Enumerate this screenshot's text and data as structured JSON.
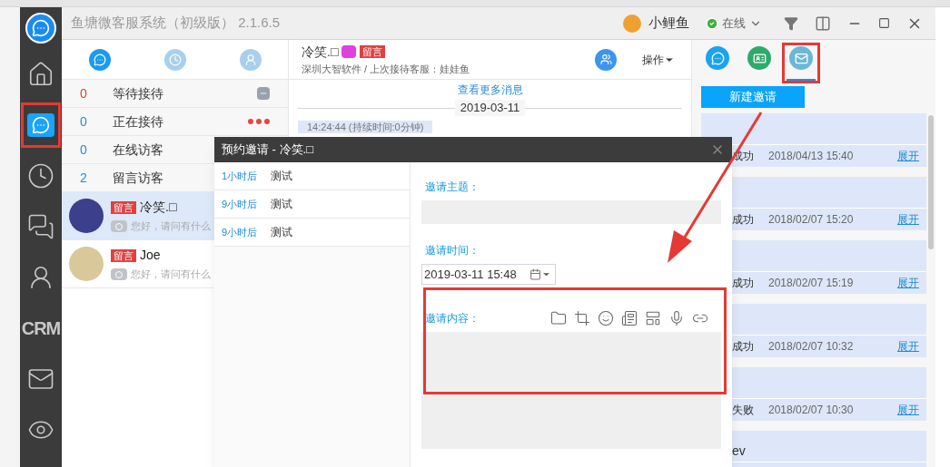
{
  "window": {
    "title": "鱼塘微客服系统（初级版） 2.1.6.5",
    "user": "小鲤鱼",
    "status": "在线"
  },
  "nav": [
    {
      "selected": false,
      "highlighted": false
    },
    {
      "selected": true,
      "highlighted": true
    },
    {
      "selected": false,
      "highlighted": false
    },
    {
      "selected": false,
      "highlighted": false
    },
    {
      "selected": false,
      "highlighted": false
    },
    {
      "label": "CRM",
      "selected": false,
      "highlighted": false
    },
    {
      "selected": false,
      "highlighted": false
    },
    {
      "selected": false,
      "highlighted": false
    }
  ],
  "visitor_tabs": [
    {
      "selected": true
    },
    {
      "selected": false
    },
    {
      "selected": false
    }
  ],
  "queues": [
    {
      "count": "0",
      "label": "等待接待",
      "color": "#e03c3c",
      "kind": "collapse"
    },
    {
      "count": "0",
      "label": "正在接待",
      "color": "#1e90e0",
      "kind": "more"
    },
    {
      "count": "0",
      "label": "在线访客",
      "color": "#1e90e0",
      "kind": "none"
    },
    {
      "count": "2",
      "label": "留言访客",
      "color": "#1e90e0",
      "kind": "none"
    }
  ],
  "conversations": [
    {
      "badge": "留言",
      "name": "冷笑.□",
      "preview": "您好，请问有什么",
      "selected": true
    },
    {
      "badge": "留言",
      "name": "Joe",
      "preview": "您好，请问有什么",
      "selected": false
    }
  ],
  "chat": {
    "name": "冷笑.□",
    "badge": "留言",
    "subtitle": "深圳大智软件 / 上次接待客服：娃娃鱼",
    "menu": "操作",
    "more_link": "查看更多消息",
    "date": "2019-03-11",
    "session": "14:24:44 (持续时间:0分钟)"
  },
  "right_tabs": [
    {
      "selected": false,
      "highlighted": false
    },
    {
      "selected": false,
      "highlighted": false
    },
    {
      "selected": true,
      "highlighted": true
    }
  ],
  "new_invite_button": "新建邀请",
  "invites": [
    {
      "status": "成功",
      "time": "2018/04/13 15:40",
      "action": "展开"
    },
    {
      "status": "成功",
      "time": "2018/02/07 15:20",
      "action": "展开"
    },
    {
      "status": "成功",
      "time": "2018/02/07 15:19",
      "action": "展开"
    },
    {
      "status": "成功",
      "time": "2018/02/07 10:32",
      "action": "展开"
    },
    {
      "status": "失败",
      "time": "2018/02/07 10:30",
      "action": "展开"
    },
    {
      "title": "ev"
    }
  ],
  "dialog": {
    "title": "预约邀请 - 冷笑.□",
    "schedule": [
      {
        "when": "1小时后",
        "title": "测试"
      },
      {
        "when": "9小时后",
        "title": "测试"
      },
      {
        "when": "9小时后",
        "title": "测试"
      }
    ],
    "subject_label": "邀请主题：",
    "time_label": "邀请时间：",
    "time_value": "2019-03-11 15:48",
    "content_label": "邀请内容：",
    "content_highlighted": true
  }
}
